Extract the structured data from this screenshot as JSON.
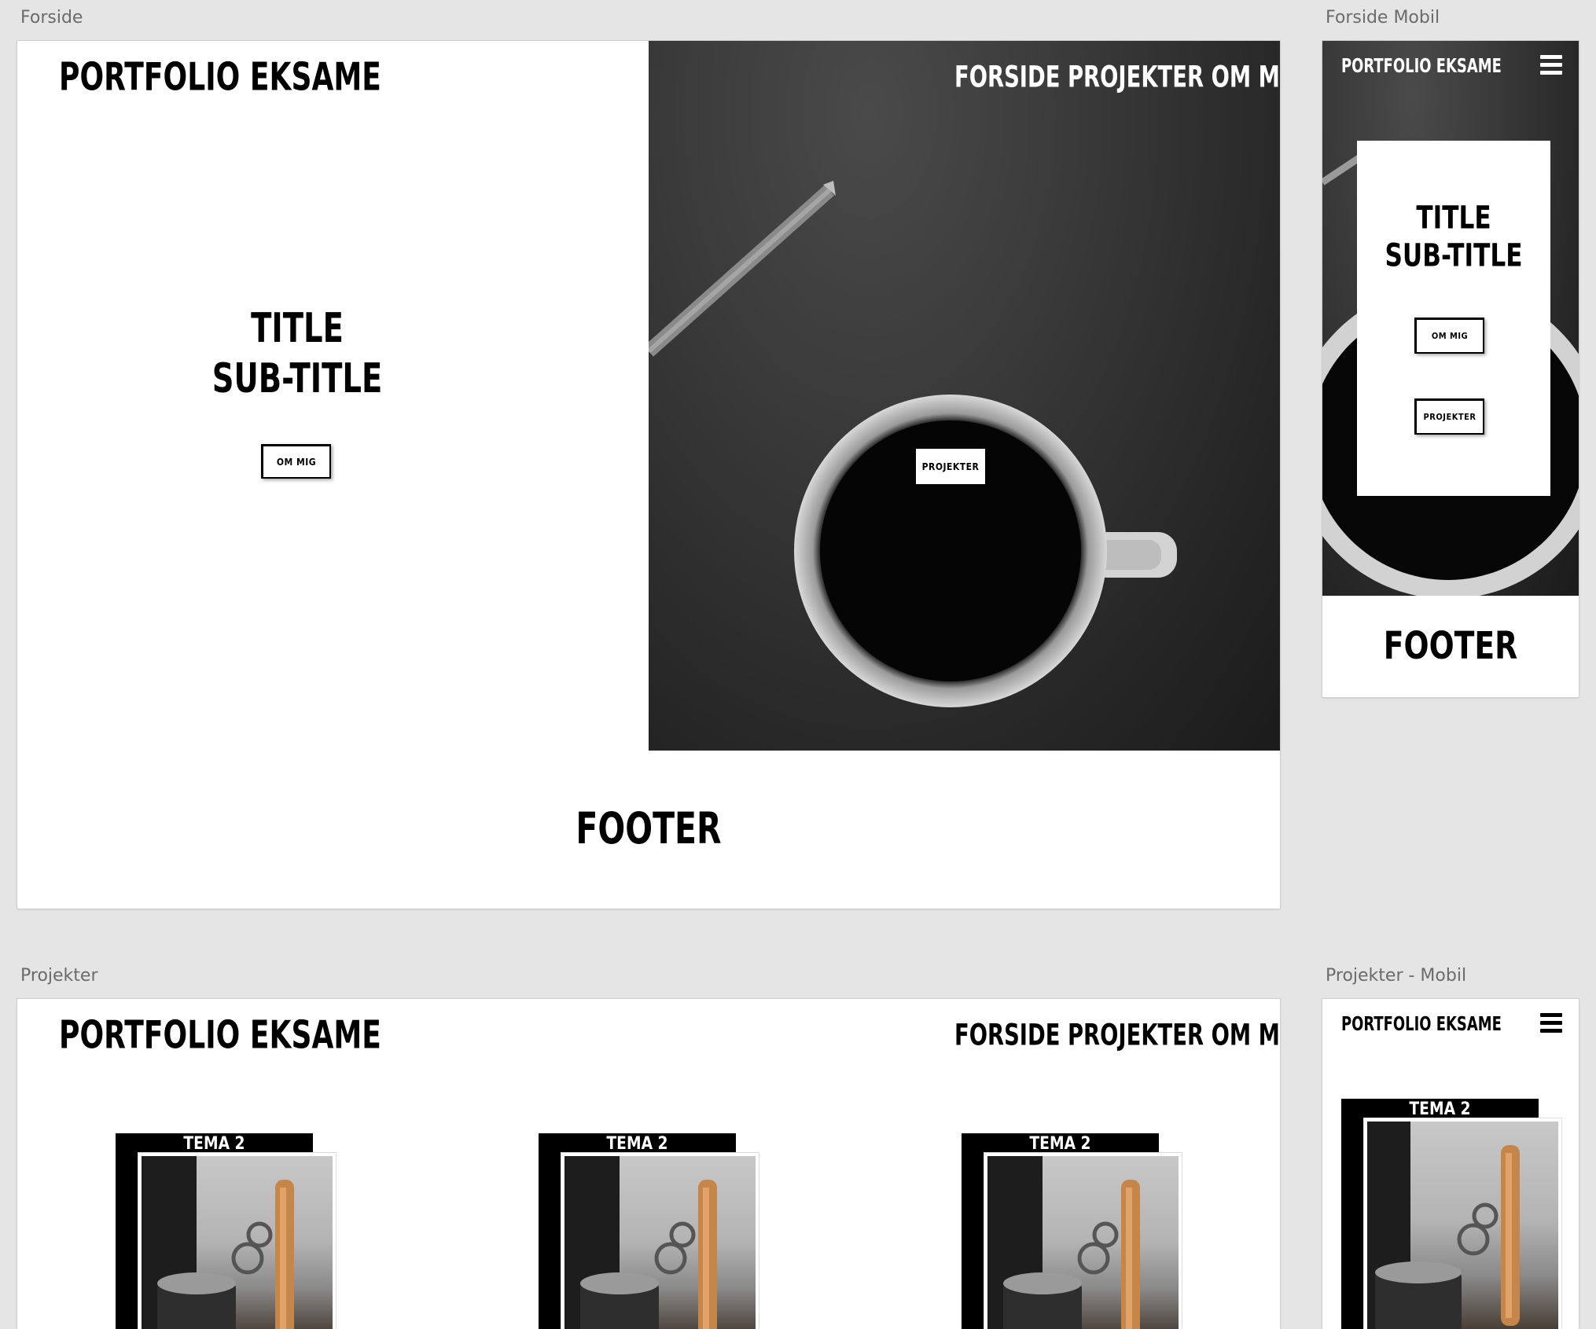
{
  "artboards": {
    "forside": "Forside",
    "forside_mobil": "Forside Mobil",
    "projekter": "Projekter",
    "projekter_mobil": "Projekter - Mobil"
  },
  "site": {
    "logo": "PORTFOLIO EKSAME",
    "nav": "FORSIDE PROJEKTER OM MIG",
    "footer": "FOOTER"
  },
  "hero": {
    "title": "TITLE",
    "subtitle": "SUB-TITLE",
    "om_mig_button": "OM MIG",
    "projekter_button": "PROJEKTER"
  },
  "projects": {
    "cards": [
      {
        "tag": "TEMA 2"
      },
      {
        "tag": "TEMA 2"
      },
      {
        "tag": "TEMA 2"
      }
    ],
    "mobile_card": {
      "tag": "TEMA 2"
    }
  },
  "icons": {
    "menu": "hamburger-menu-icon"
  }
}
